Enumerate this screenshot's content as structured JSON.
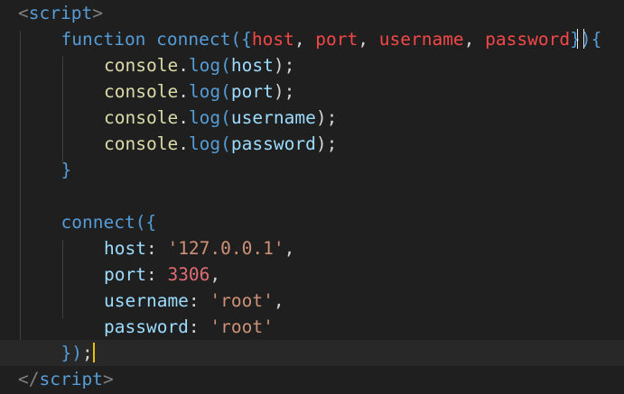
{
  "editor": {
    "language": "html",
    "cursor_color": "#e6c300",
    "lines": [
      {
        "id": 1,
        "indent": 0,
        "tokens": [
          {
            "text": "<",
            "kind": "bracket"
          },
          {
            "text": "script",
            "kind": "tag"
          },
          {
            "text": ">",
            "kind": "bracket"
          }
        ]
      },
      {
        "id": 2,
        "indent": 1,
        "tokens": [
          {
            "text": "function",
            "kind": "kw"
          },
          {
            "text": " ",
            "kind": "punct"
          },
          {
            "text": "connect",
            "kind": "kw"
          },
          {
            "text": "({",
            "kind": "kw"
          },
          {
            "text": "host",
            "kind": "param"
          },
          {
            "text": ", ",
            "kind": "punct"
          },
          {
            "text": "port",
            "kind": "param"
          },
          {
            "text": ", ",
            "kind": "punct"
          },
          {
            "text": "username",
            "kind": "param"
          },
          {
            "text": ", ",
            "kind": "punct"
          },
          {
            "text": "password",
            "kind": "param"
          },
          {
            "text": "}",
            "kind": "kw"
          },
          {
            "text": "",
            "kind": "ibeam"
          },
          {
            "text": "){",
            "kind": "kw"
          }
        ]
      },
      {
        "id": 3,
        "indent": 2,
        "tokens": [
          {
            "text": "console",
            "kind": "fn"
          },
          {
            "text": ".",
            "kind": "punct"
          },
          {
            "text": "log",
            "kind": "kw"
          },
          {
            "text": "(",
            "kind": "kw"
          },
          {
            "text": "host",
            "kind": "var"
          },
          {
            "text": ");",
            "kind": "punct"
          }
        ]
      },
      {
        "id": 4,
        "indent": 2,
        "tokens": [
          {
            "text": "console",
            "kind": "fn"
          },
          {
            "text": ".",
            "kind": "punct"
          },
          {
            "text": "log",
            "kind": "kw"
          },
          {
            "text": "(",
            "kind": "kw"
          },
          {
            "text": "port",
            "kind": "var"
          },
          {
            "text": ");",
            "kind": "punct"
          }
        ]
      },
      {
        "id": 5,
        "indent": 2,
        "tokens": [
          {
            "text": "console",
            "kind": "fn"
          },
          {
            "text": ".",
            "kind": "punct"
          },
          {
            "text": "log",
            "kind": "kw"
          },
          {
            "text": "(",
            "kind": "kw"
          },
          {
            "text": "username",
            "kind": "var"
          },
          {
            "text": ");",
            "kind": "punct"
          }
        ]
      },
      {
        "id": 6,
        "indent": 2,
        "tokens": [
          {
            "text": "console",
            "kind": "fn"
          },
          {
            "text": ".",
            "kind": "punct"
          },
          {
            "text": "log",
            "kind": "kw"
          },
          {
            "text": "(",
            "kind": "kw"
          },
          {
            "text": "password",
            "kind": "var"
          },
          {
            "text": ");",
            "kind": "punct"
          }
        ]
      },
      {
        "id": 7,
        "indent": 1,
        "tokens": [
          {
            "text": "}",
            "kind": "kw"
          }
        ]
      },
      {
        "id": 8,
        "indent": 0,
        "tokens": []
      },
      {
        "id": 9,
        "indent": 1,
        "tokens": [
          {
            "text": "connect",
            "kind": "kw"
          },
          {
            "text": "({",
            "kind": "kw"
          }
        ]
      },
      {
        "id": 10,
        "indent": 2,
        "tokens": [
          {
            "text": "host",
            "kind": "var"
          },
          {
            "text": ": ",
            "kind": "punct"
          },
          {
            "text": "'127.0.0.1'",
            "kind": "str"
          },
          {
            "text": ",",
            "kind": "punct"
          }
        ]
      },
      {
        "id": 11,
        "indent": 2,
        "tokens": [
          {
            "text": "port",
            "kind": "var"
          },
          {
            "text": ": ",
            "kind": "punct"
          },
          {
            "text": "3306",
            "kind": "num"
          },
          {
            "text": ",",
            "kind": "punct"
          }
        ]
      },
      {
        "id": 12,
        "indent": 2,
        "tokens": [
          {
            "text": "username",
            "kind": "var"
          },
          {
            "text": ": ",
            "kind": "punct"
          },
          {
            "text": "'root'",
            "kind": "str"
          },
          {
            "text": ",",
            "kind": "punct"
          }
        ]
      },
      {
        "id": 13,
        "indent": 2,
        "tokens": [
          {
            "text": "password",
            "kind": "var"
          },
          {
            "text": ": ",
            "kind": "punct"
          },
          {
            "text": "'root'",
            "kind": "str"
          }
        ]
      },
      {
        "id": 14,
        "indent": 1,
        "active": true,
        "tokens": [
          {
            "text": "})",
            "kind": "kw"
          },
          {
            "text": ";",
            "kind": "punct"
          },
          {
            "text": "",
            "kind": "cursor"
          }
        ]
      },
      {
        "id": 15,
        "indent": 0,
        "tokens": [
          {
            "text": "</",
            "kind": "bracket"
          },
          {
            "text": "script",
            "kind": "tag"
          },
          {
            "text": ">",
            "kind": "bracket"
          }
        ]
      }
    ]
  }
}
